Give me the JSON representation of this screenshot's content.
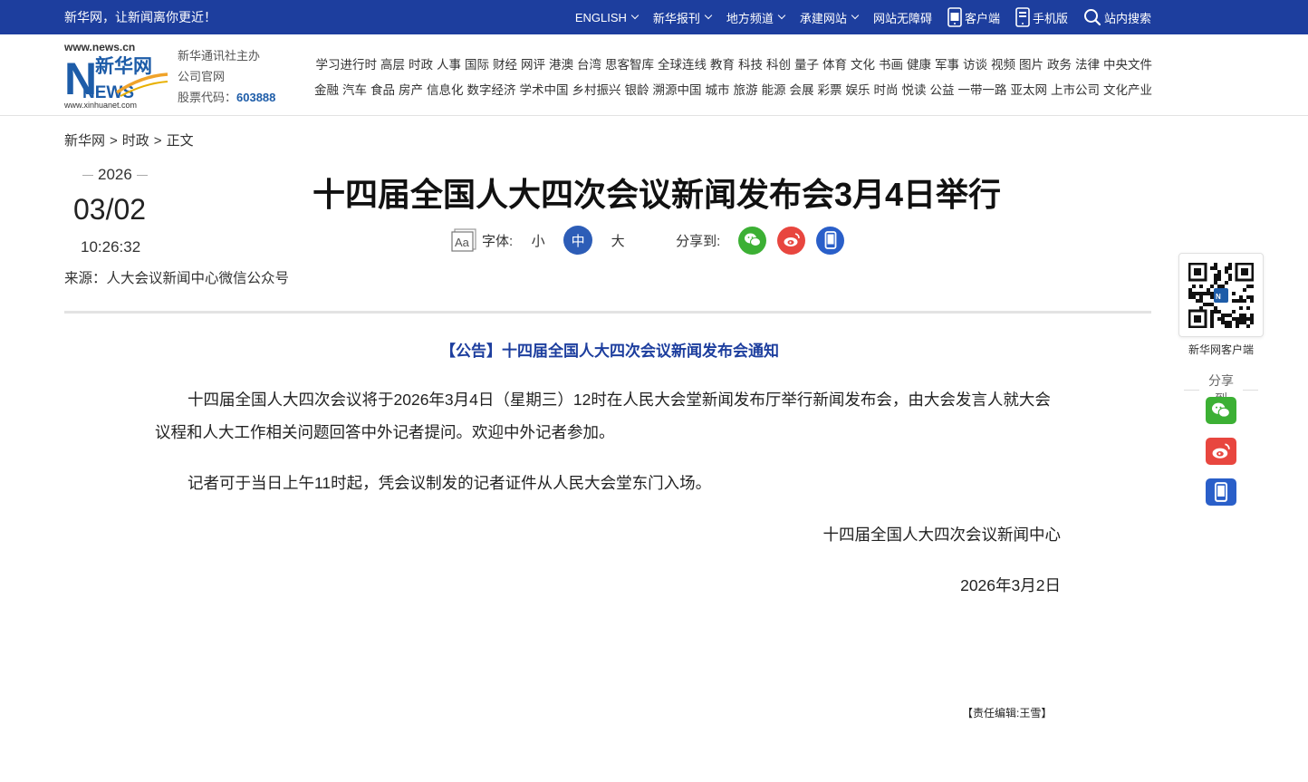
{
  "topbar": {
    "slogan": "新华网，让新闻离你更近！",
    "items": [
      "ENGLISH",
      "新华报刊",
      "地方频道",
      "承建网站",
      "网站无障碍",
      "客户端",
      "手机版",
      "站内搜索"
    ]
  },
  "logo": {
    "domain": "www.news.cn",
    "brand": "新华网",
    "news": "NEWS",
    "sub_domain": "www.xinhuanet.com"
  },
  "org": {
    "line1": "新华通讯社主办",
    "line2": "公司官网",
    "stock_label": "股票代码：",
    "stock_code": "603888"
  },
  "nav": {
    "row1": [
      "学习进行时",
      "高层",
      "时政",
      "人事",
      "国际",
      "财经",
      "网评",
      "港澳",
      "台湾",
      "思客智库",
      "全球连线",
      "教育",
      "科技",
      "科创",
      "量子",
      "体育",
      "文化",
      "书画",
      "健康",
      "军事",
      "访谈",
      "视频",
      "图片",
      "政务",
      "法律",
      "中央文件"
    ],
    "row2": [
      "金融",
      "汽车",
      "食品",
      "房产",
      "信息化",
      "数字经济",
      "学术中国",
      "乡村振兴",
      "银龄",
      "溯源中国",
      "城市",
      "旅游",
      "能源",
      "会展",
      "彩票",
      "娱乐",
      "时尚",
      "悦读",
      "公益",
      "一带一路",
      "亚太网",
      "上市公司",
      "文化产业"
    ]
  },
  "breadcrumb": {
    "home": "新华网",
    "section": "时政",
    "current": "正文",
    "sep": ">"
  },
  "meta": {
    "year": "2026",
    "date": "03/02",
    "time": "10:26:32",
    "source": "来源：人大会议新闻中心微信公众号"
  },
  "article": {
    "title": "十四届全国人大四次会议新闻发布会3月4日举行",
    "font_label": "字体:",
    "font_small": "小",
    "font_medium": "中",
    "font_large": "大",
    "share_label": "分享到:",
    "notice_head": "【公告】十四届全国人大四次会议新闻发布会通知",
    "para1": "十四届全国人大四次会议将于2026年3月4日（星期三）12时在人民大会堂新闻发布厅举行新闻发布会，由大会发言人就大会议程和人大工作相关问题回答中外记者提问。欢迎中外记者参加。",
    "para2": "记者可于当日上午11时起，凭会议制发的记者证件从人民大会堂东门入场。",
    "sign_org": "十四届全国人大四次会议新闻中心",
    "sign_date": "2026年3月2日",
    "editor": "【责任编辑:王雪】"
  },
  "sidebar": {
    "qr_caption": "新华网客户端",
    "share_label": "分享到"
  },
  "colors": {
    "topbar": "#1d3e9e",
    "accent": "#2d5db7",
    "wechat": "#3cb034",
    "weibo": "#e8463f",
    "mobile": "#2a5fc9"
  }
}
